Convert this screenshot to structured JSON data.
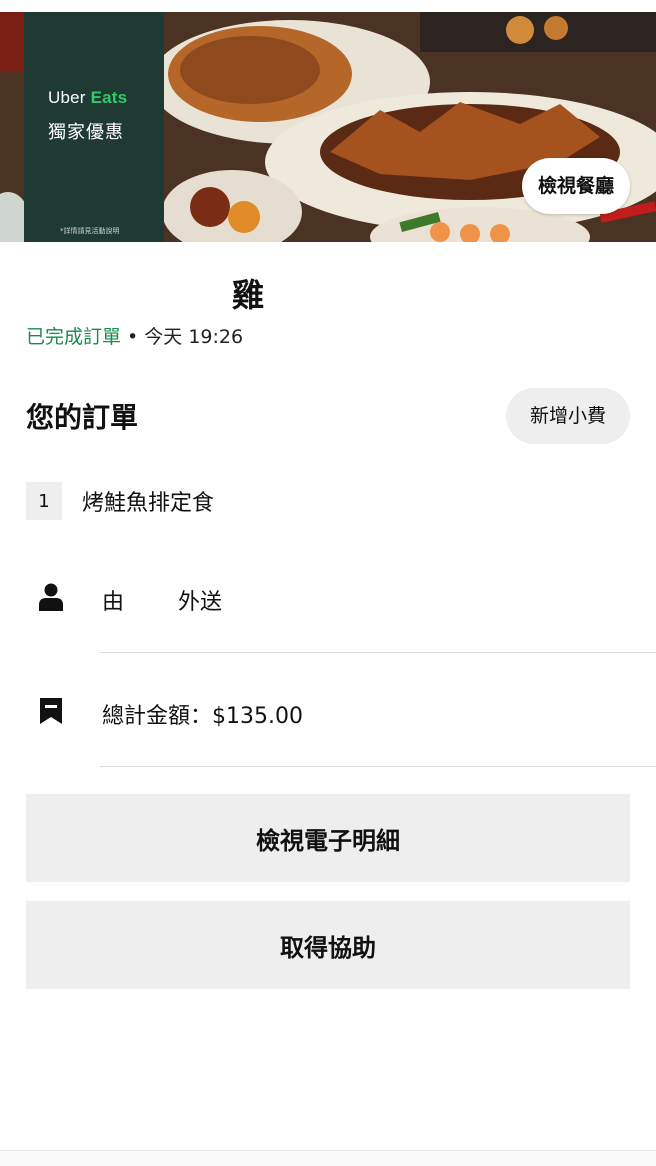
{
  "banner": {
    "brand_prefix": "Uber",
    "brand_suffix": "Eats",
    "promo_title": "獨家優惠",
    "promo_note": "*詳情請見活動說明",
    "view_restaurant_label": "檢視餐廳"
  },
  "order": {
    "restaurant_name": "雞",
    "status": "已完成訂單",
    "time": " • 今天 19:26",
    "section_title": "您的訂單",
    "add_tip_label": "新增小費",
    "items": [
      {
        "qty": "1",
        "name": "烤鮭魚排定食"
      }
    ],
    "courier_prefix": "由",
    "courier_suffix": "外送",
    "total_label": "總計金額：$135.00"
  },
  "actions": {
    "view_receipt_label": "檢視電子明細",
    "get_help_label": "取得協助"
  },
  "icons": {
    "courier": "person-icon",
    "receipt": "receipt-icon"
  },
  "colors": {
    "status_green": "#1c8a4e",
    "promo_panel": "#1f3a33",
    "brand_green": "#34c86b",
    "button_bg": "#eeeeee"
  }
}
